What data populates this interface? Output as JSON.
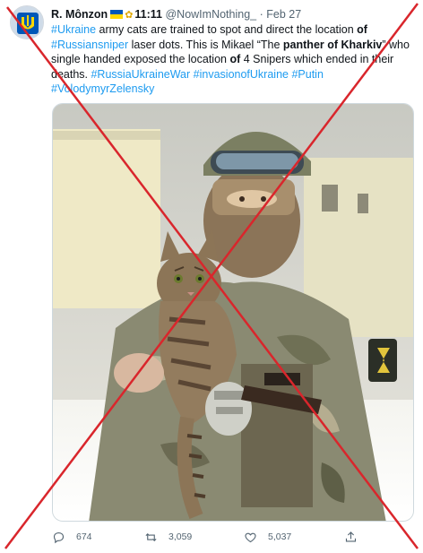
{
  "tweet": {
    "author_name": "R. Mônzon",
    "time_text": "11:11",
    "handle": "@NowImNothing_",
    "separator": "·",
    "date": "Feb 27",
    "text": {
      "t1": "#Ukraine",
      "t2": " army cats are trained to spot and direct the location ",
      "t3": "of",
      "t4": " ",
      "t5": "#Russiansniper",
      "t6": " laser dots. This is Mikael “The ",
      "t7": "panther of",
      "t8": "  ",
      "t9": "Kharkiv",
      "t10": "” who single handed exposed the location ",
      "t11": "of",
      "t12": " 4 Snipers which ended in their deaths. ",
      "t13": "#RussiaUkraineWar",
      "t14": " ",
      "t15": "#invasionofUkraine",
      "t16": " ",
      "t17": "#Putin",
      "t18": " ",
      "t19": "#VolodymyrZelensky"
    },
    "stats": {
      "replies": "674",
      "retweets": "3,059",
      "likes": "5,037"
    }
  },
  "icons": {
    "avatar": "avatar-ukraine-emblem",
    "reply": "reply-icon",
    "retweet": "retweet-icon",
    "like": "heart-icon",
    "share": "share-icon"
  },
  "colors": {
    "link": "#1d9bf0",
    "muted": "#536471",
    "cross": "#d9262c",
    "flag_blue": "#0057b7",
    "flag_yellow": "#ffd700"
  }
}
